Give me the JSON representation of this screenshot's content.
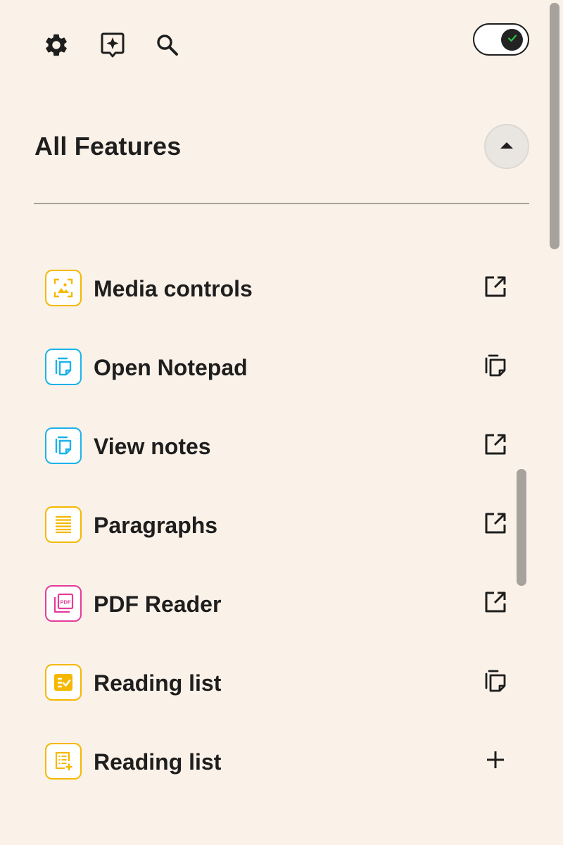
{
  "toolbar": {
    "settings_icon": "gear-icon",
    "ai_icon": "sparkle-chat-icon",
    "search_icon": "search-icon",
    "toggle_state": "on",
    "toggle_check_color": "#2EBE4A"
  },
  "section": {
    "title": "All Features",
    "collapse_icon": "caret-up-icon"
  },
  "features": [
    {
      "label": "Media controls",
      "icon": "media-icon",
      "color": "#F5B800",
      "action": "external-link-icon"
    },
    {
      "label": "Open Notepad",
      "icon": "notepad-icon",
      "color": "#1BB3E9",
      "action": "copy-icon"
    },
    {
      "label": "View notes",
      "icon": "notepad-icon",
      "color": "#1BB3E9",
      "action": "external-link-icon"
    },
    {
      "label": "Paragraphs",
      "icon": "paragraphs-icon",
      "color": "#F5B800",
      "action": "external-link-icon"
    },
    {
      "label": "PDF Reader",
      "icon": "pdf-icon",
      "color": "#E63B9A",
      "action": "external-link-icon"
    },
    {
      "label": "Reading list",
      "icon": "checklist-icon",
      "color": "#F5B800",
      "action": "copy-icon"
    },
    {
      "label": "Reading list",
      "icon": "list-add-icon",
      "color": "#F5B800",
      "action": "plus-icon"
    }
  ]
}
